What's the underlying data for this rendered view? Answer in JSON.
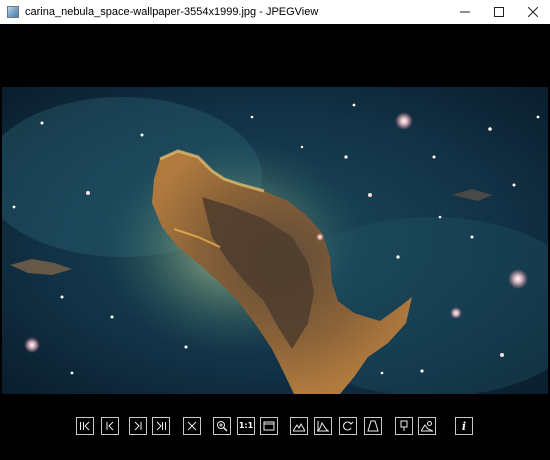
{
  "window": {
    "title": "carina_nebula_space-wallpaper-3554x1999.jpg - JPEGView",
    "app_icon": "jpegview-icon",
    "buttons": [
      "minimize-icon",
      "maximize-icon",
      "close-icon"
    ]
  },
  "image": {
    "description_icon": "photo",
    "colors": {
      "space": "#0e2a3c",
      "nebula": "#9a6a3a",
      "glow": "#c9d49a"
    }
  },
  "toolbar": {
    "buttons": [
      {
        "icon": "first-image-icon"
      },
      {
        "icon": "previous-image-icon"
      },
      {
        "icon": "next-image-icon"
      },
      {
        "icon": "last-image-icon"
      },
      {
        "icon": "close-image-icon"
      },
      {
        "icon": "zoom-in-icon"
      },
      {
        "icon": "actual-size-icon",
        "label": "1:1"
      },
      {
        "icon": "fit-window-icon"
      },
      {
        "icon": "landscape-enhance-icon"
      },
      {
        "icon": "histogram-icon"
      },
      {
        "icon": "rotate-icon"
      },
      {
        "icon": "perspective-correction-icon"
      },
      {
        "icon": "keep-parameters-icon"
      },
      {
        "icon": "save-parameters-icon"
      },
      {
        "icon": "info-icon",
        "label": "i"
      }
    ]
  }
}
